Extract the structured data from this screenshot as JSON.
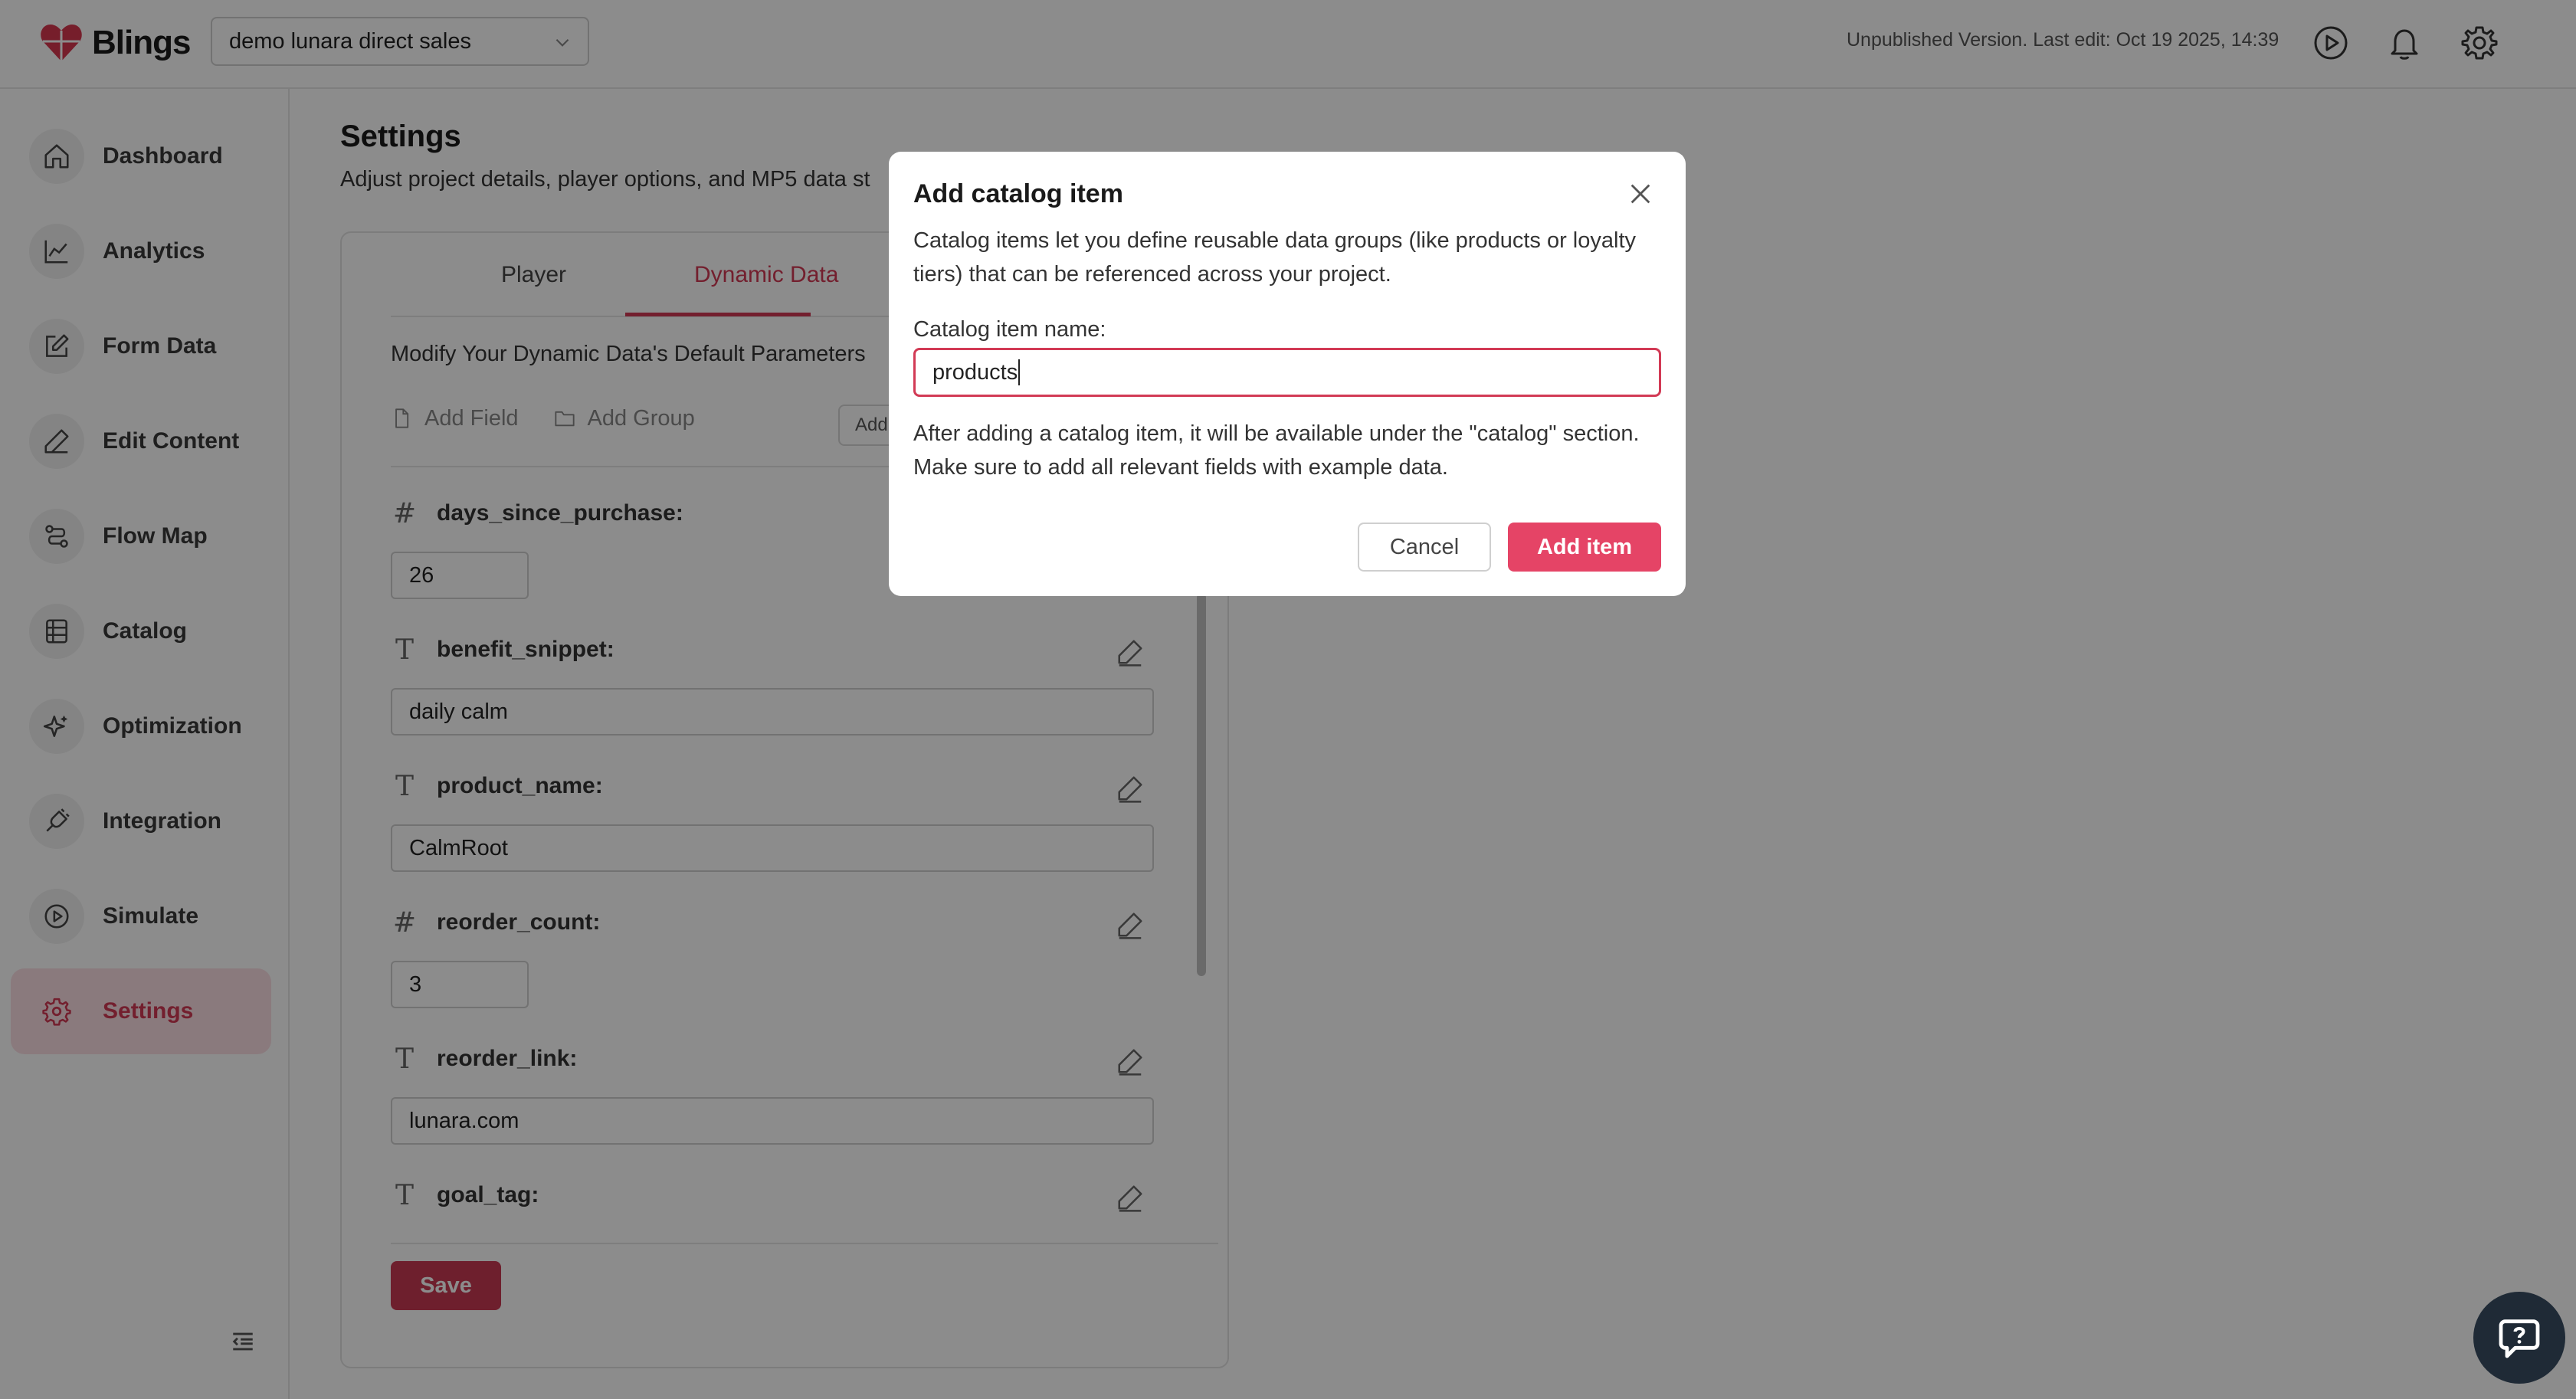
{
  "header": {
    "logo_text": "Blings",
    "project_name": "demo lunara direct sales",
    "status": "Unpublished Version. Last edit: Oct 19 2025, 14:39",
    "icons": [
      "play-circle-icon",
      "bell-icon",
      "gear-icon"
    ]
  },
  "sidebar": {
    "items": [
      {
        "label": "Dashboard",
        "icon": "home-icon"
      },
      {
        "label": "Analytics",
        "icon": "line-chart-icon"
      },
      {
        "label": "Form Data",
        "icon": "edit-square-icon"
      },
      {
        "label": "Edit Content",
        "icon": "pencil-icon"
      },
      {
        "label": "Flow Map",
        "icon": "flow-icon"
      },
      {
        "label": "Catalog",
        "icon": "catalog-icon"
      },
      {
        "label": "Optimization",
        "icon": "sparkle-icon"
      },
      {
        "label": "Integration",
        "icon": "plug-icon"
      },
      {
        "label": "Simulate",
        "icon": "play-circle-icon"
      },
      {
        "label": "Settings",
        "icon": "gear-icon"
      }
    ],
    "active": "Settings"
  },
  "main": {
    "title": "Settings",
    "subtitle": "Adjust project details, player options, and MP5 data st",
    "tabs": [
      {
        "label": "Player"
      },
      {
        "label": "Dynamic Data"
      }
    ],
    "active_tab": "Dynamic Data",
    "card_subtitle": "Modify Your Dynamic Data's Default Parameters",
    "toolbar": {
      "add_field": "Add Field",
      "add_group": "Add Group",
      "add_btn": "Add"
    },
    "fields": [
      {
        "type": "#",
        "name": "days_since_purchase:",
        "value": "26"
      },
      {
        "type": "T",
        "name": "benefit_snippet:",
        "value": "daily calm"
      },
      {
        "type": "T",
        "name": "product_name:",
        "value": "CalmRoot"
      },
      {
        "type": "#",
        "name": "reorder_count:",
        "value": "3"
      },
      {
        "type": "T",
        "name": "reorder_link:",
        "value": "lunara.com"
      },
      {
        "type": "T",
        "name": "goal_tag:",
        "value": ""
      }
    ],
    "save_label": "Save"
  },
  "modal": {
    "title": "Add catalog item",
    "description": "Catalog items let you define reusable data groups (like products or loyalty tiers) that can be referenced across your project.",
    "input_label": "Catalog item name:",
    "input_value": "products",
    "note": "After adding a catalog item, it will be available under the \"catalog\" section. Make sure to add all relevant fields with example data.",
    "cancel_label": "Cancel",
    "add_label": "Add item"
  },
  "colors": {
    "accent": "#e54466",
    "accent_dark": "#c93a52",
    "active_bg": "#fbdfe3"
  }
}
